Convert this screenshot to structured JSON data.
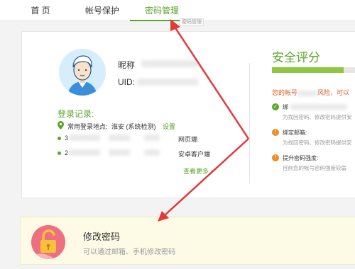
{
  "nav": {
    "tabs": [
      {
        "label": "首 页",
        "active": false
      },
      {
        "label": "帐号保护",
        "active": false
      },
      {
        "label": "密码管理",
        "active": true
      }
    ],
    "tooltip_fragment": "密码管理",
    "active_color": "#5aa52c"
  },
  "profile": {
    "nickname_label": "昵称",
    "uid_label": "UID:"
  },
  "login": {
    "title": "登录记录:",
    "location_label": "常用登录地点:",
    "location_value": "淮安 (系统检测)",
    "location_link": "设置",
    "records": [
      {
        "ip": "3",
        "device": "网页端"
      },
      {
        "ip": "2",
        "device": "安卓客户端"
      }
    ],
    "more_link": "查看更多 >"
  },
  "security": {
    "title": "安全评分",
    "score_fraction": 0.86,
    "warning": "您的帐号",
    "warning_tail": "风险，可以",
    "items": [
      {
        "icon": "check-icon",
        "status": "ok",
        "title": "绑",
        "desc": "为找回密码、修改密码提供安"
      },
      {
        "icon": "warning-icon",
        "status": "warn",
        "title": "绑定邮箱:",
        "desc": "为找回密码、修改密码提供安"
      },
      {
        "icon": "warning-icon",
        "status": "warn",
        "title": "提升密码强度:",
        "desc": "目前您的帐号密码强度较弱"
      }
    ]
  },
  "password_card": {
    "title": "修改密码",
    "desc": "可以通过邮箱、手机修改密码"
  },
  "colors": {
    "accent_green": "#5aa52c",
    "warning_orange": "#ee8b22",
    "annotation_red": "#e23a3a",
    "lock_badge": "#ee7080"
  }
}
